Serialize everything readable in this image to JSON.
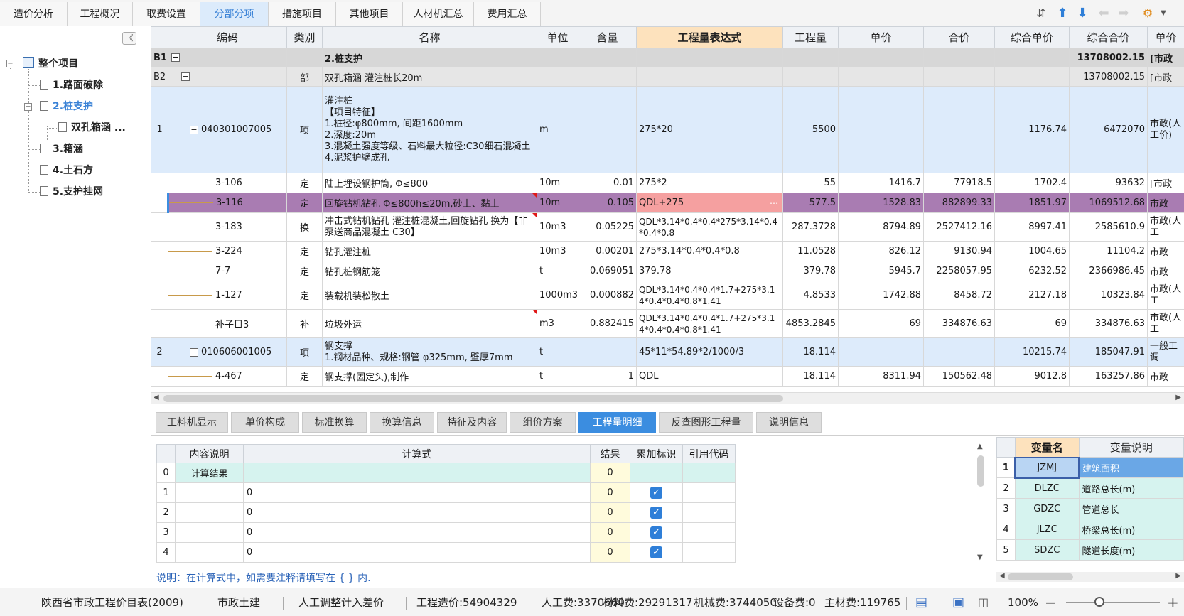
{
  "top_tabs": [
    "造价分析",
    "工程概况",
    "取费设置",
    "分部分项",
    "措施项目",
    "其他项目",
    "人材机汇总",
    "费用汇总"
  ],
  "active_tab": 3,
  "tree": {
    "collapse_label": "《",
    "root": "整个项目",
    "items": [
      "1.路面破除",
      "2.桩支护",
      "双孔箱涵 ...",
      "3.箱涵",
      "4.土石方",
      "5.支护挂网"
    ]
  },
  "grid": {
    "columns": [
      "",
      "编码",
      "类别",
      "名称",
      "单位",
      "含量",
      "工程量表达式",
      "工程量",
      "单价",
      "合价",
      "综合单价",
      "综合合价",
      "单价"
    ],
    "rows": [
      {
        "seq": "B1",
        "code": "",
        "cat": "",
        "name": "2.桩支护",
        "unit": "",
        "content": "",
        "expr": "",
        "qty": "",
        "price": "",
        "total": "",
        "uprice": "",
        "utotal": "13708002.15",
        "last": "[市政"
      },
      {
        "seq": "B2",
        "code": "",
        "cat": "部",
        "name": "双孔箱涵 灌注桩长20m",
        "unit": "",
        "content": "",
        "expr": "",
        "qty": "",
        "price": "",
        "total": "",
        "uprice": "",
        "utotal": "13708002.15",
        "last": "[市政"
      },
      {
        "seq": "1",
        "code": "040301007005",
        "cat": "项",
        "name": "灌注桩\n【项目特征】\n1.桩径:φ800mm, 间距1600mm\n2.深度:20m\n3.混凝土强度等级、石料最大粒径:C30细石混凝土\n4.泥浆护壁成孔",
        "unit": "m",
        "content": "",
        "expr": "275*20",
        "qty": "5500",
        "price": "",
        "total": "",
        "uprice": "1176.74",
        "utotal": "6472070",
        "last": "市政(人工价)"
      },
      {
        "seq": "",
        "code": "3-106",
        "cat": "定",
        "name": "陆上埋设钢护筒, Φ≤800",
        "unit": "10m",
        "content": "0.01",
        "expr": "275*2",
        "qty": "55",
        "price": "1416.7",
        "total": "77918.5",
        "uprice": "1702.4",
        "utotal": "93632",
        "last": "[市政"
      },
      {
        "seq": "",
        "code": "3-116",
        "cat": "定",
        "name": "回旋钻机钻孔 Φ≤800h≤20m,砂土、黏土",
        "unit": "10m",
        "content": "0.105",
        "expr": "QDL+275",
        "qty": "577.5",
        "price": "1528.83",
        "total": "882899.33",
        "uprice": "1851.97",
        "utotal": "1069512.68",
        "last": "市政"
      },
      {
        "seq": "",
        "code": "3-183",
        "cat": "换",
        "name": "冲击式钻机钻孔 灌注桩混凝土,回旋钻孔 换为【非泵送商品混凝土 C30】",
        "unit": "10m3",
        "content": "0.05225",
        "expr": "QDL*3.14*0.4*0.4*275*3.14*0.4*0.4*0.8",
        "qty": "287.3728",
        "price": "8794.89",
        "total": "2527412.16",
        "uprice": "8997.41",
        "utotal": "2585610.9",
        "last": "市政(人工"
      },
      {
        "seq": "",
        "code": "3-224",
        "cat": "定",
        "name": "钻孔灌注桩",
        "unit": "10m3",
        "content": "0.00201",
        "expr": "275*3.14*0.4*0.4*0.8",
        "qty": "11.0528",
        "price": "826.12",
        "total": "9130.94",
        "uprice": "1004.65",
        "utotal": "11104.2",
        "last": "市政"
      },
      {
        "seq": "",
        "code": "7-7",
        "cat": "定",
        "name": "钻孔桩钢筋笼",
        "unit": "t",
        "content": "0.069051",
        "expr": "379.78",
        "qty": "379.78",
        "price": "5945.7",
        "total": "2258057.95",
        "uprice": "6232.52",
        "utotal": "2366986.45",
        "last": "市政"
      },
      {
        "seq": "",
        "code": "1-127",
        "cat": "定",
        "name": "装载机装松散土",
        "unit": "1000m3",
        "content": "0.000882",
        "expr": "QDL*3.14*0.4*0.4*1.7+275*3.14*0.4*0.4*0.8*1.41",
        "qty": "4.8533",
        "price": "1742.88",
        "total": "8458.72",
        "uprice": "2127.18",
        "utotal": "10323.84",
        "last": "市政(人工"
      },
      {
        "seq": "",
        "code": "补子目3",
        "cat": "补",
        "name": "垃圾外运",
        "unit": "m3",
        "content": "0.882415",
        "expr": "QDL*3.14*0.4*0.4*1.7+275*3.14*0.4*0.4*0.8*1.41",
        "qty": "4853.2845",
        "price": "69",
        "total": "334876.63",
        "uprice": "69",
        "utotal": "334876.63",
        "last": "市政(人工"
      },
      {
        "seq": "2",
        "code": "010606001005",
        "cat": "项",
        "name": "钢支撑\n1.钢材品种、规格:钢管 φ325mm, 壁厚7mm",
        "unit": "t",
        "content": "",
        "expr": "45*11*54.89*2/1000/3",
        "qty": "18.114",
        "price": "",
        "total": "",
        "uprice": "10215.74",
        "utotal": "185047.91",
        "last": "一般工调"
      },
      {
        "seq": "",
        "code": "4-467",
        "cat": "定",
        "name": "钢支撑(固定头),制作",
        "unit": "t",
        "content": "1",
        "expr": "QDL",
        "qty": "18.114",
        "price": "8311.94",
        "total": "150562.48",
        "uprice": "9012.8",
        "utotal": "163257.86",
        "last": "市政"
      }
    ]
  },
  "bottom_tabs": [
    "工料机显示",
    "单价构成",
    "标准换算",
    "换算信息",
    "特征及内容",
    "组价方案",
    "工程量明细",
    "反查图形工程量",
    "说明信息"
  ],
  "active_bottom_tab": 6,
  "detail": {
    "columns": [
      "",
      "内容说明",
      "计算式",
      "结果",
      "累加标识",
      "引用代码"
    ],
    "rows": [
      {
        "idx": "0",
        "desc": "计算结果",
        "formula": "",
        "result": "0",
        "checked": false
      },
      {
        "idx": "1",
        "desc": "",
        "formula": "0",
        "result": "0",
        "checked": true
      },
      {
        "idx": "2",
        "desc": "",
        "formula": "0",
        "result": "0",
        "checked": true
      },
      {
        "idx": "3",
        "desc": "",
        "formula": "0",
        "result": "0",
        "checked": true
      },
      {
        "idx": "4",
        "desc": "",
        "formula": "0",
        "result": "0",
        "checked": true
      }
    ],
    "note": "说明：在计算式中，如需要注释请填写在 { } 内."
  },
  "variables": {
    "columns": [
      "",
      "变量名",
      "变量说明"
    ],
    "rows": [
      {
        "idx": "1",
        "name": "JZMJ",
        "desc": "建筑面积"
      },
      {
        "idx": "2",
        "name": "DLZC",
        "desc": "道路总长(m)"
      },
      {
        "idx": "3",
        "name": "GDZC",
        "desc": "管道总长"
      },
      {
        "idx": "4",
        "name": "JLZC",
        "desc": "桥梁总长(m)"
      },
      {
        "idx": "5",
        "name": "SDZC",
        "desc": "隧道长度(m)"
      }
    ]
  },
  "status": {
    "catalog": "陕西省市政工程价目表(2009)",
    "major": "市政土建",
    "labor_adj": "人工调整计入差价",
    "cost": "工程造价:54904329",
    "labor": "人工费:3370660",
    "material": "材料费:29291317",
    "machine": "机械费:3744050",
    "equip": "设备费:0",
    "main_mat": "主材费:119765",
    "zoom": "100%"
  },
  "colors": {
    "accent": "#3b8de0",
    "selected_row": "#a97cb2",
    "expr_cell": "#f5a0a0",
    "header_highlight": "#fde2bd",
    "qd_row": "#ddebfb"
  }
}
